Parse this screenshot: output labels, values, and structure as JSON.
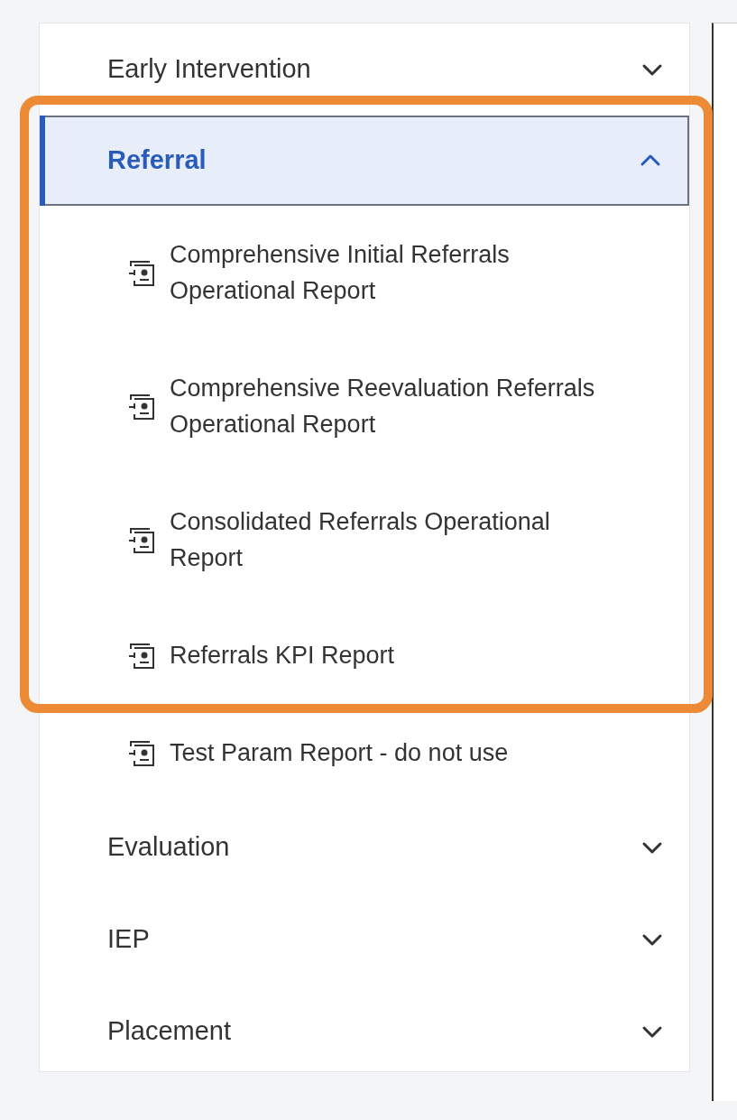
{
  "sidebar": {
    "categories": [
      {
        "label": "Early Intervention",
        "expanded": false,
        "selected": false
      },
      {
        "label": "Referral",
        "expanded": true,
        "selected": true,
        "reports": [
          {
            "label": "Comprehensive Initial Referrals Operational Report",
            "highlighted": true
          },
          {
            "label": "Comprehensive Reevaluation Referrals Operational Report",
            "highlighted": true
          },
          {
            "label": "Consolidated Referrals Operational Report",
            "highlighted": true
          },
          {
            "label": "Referrals KPI Report",
            "highlighted": true
          },
          {
            "label": "Test Param Report - do not use",
            "highlighted": false
          }
        ]
      },
      {
        "label": "Evaluation",
        "expanded": false,
        "selected": false
      },
      {
        "label": "IEP",
        "expanded": false,
        "selected": false
      },
      {
        "label": "Placement",
        "expanded": false,
        "selected": false
      }
    ]
  }
}
